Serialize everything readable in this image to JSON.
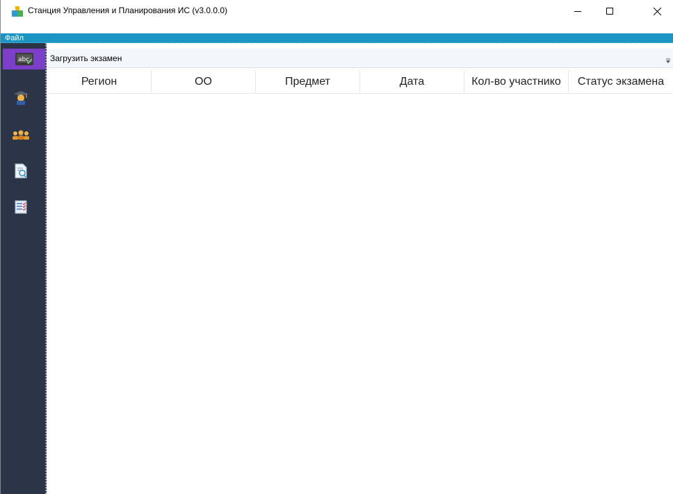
{
  "window": {
    "title": "Станция Управления и Планирования ИС (v3.0.0.0)"
  },
  "menu": {
    "items": [
      {
        "label": "Файл"
      }
    ]
  },
  "sidebar": {
    "items": [
      {
        "icon": "spellcheck-abc-icon",
        "active": true
      },
      {
        "icon": "graduate-icon",
        "active": false
      },
      {
        "icon": "users-group-icon",
        "active": false
      },
      {
        "icon": "document-search-icon",
        "active": false
      },
      {
        "icon": "checklist-icon",
        "active": false
      }
    ]
  },
  "toolbar": {
    "load_exam_label": "Загрузить экзамен"
  },
  "grid": {
    "columns": [
      {
        "label": "Регион"
      },
      {
        "label": "ОО"
      },
      {
        "label": "Предмет"
      },
      {
        "label": "Дата"
      },
      {
        "label": "Кол-во участнико"
      },
      {
        "label": "Статус экзамена"
      }
    ],
    "rows": []
  },
  "colors": {
    "menubar": "#1a95c4",
    "sidebar": "#2c3447",
    "sidebar_active": "#7b3fc9",
    "toolbar": "#f3f6fa"
  }
}
